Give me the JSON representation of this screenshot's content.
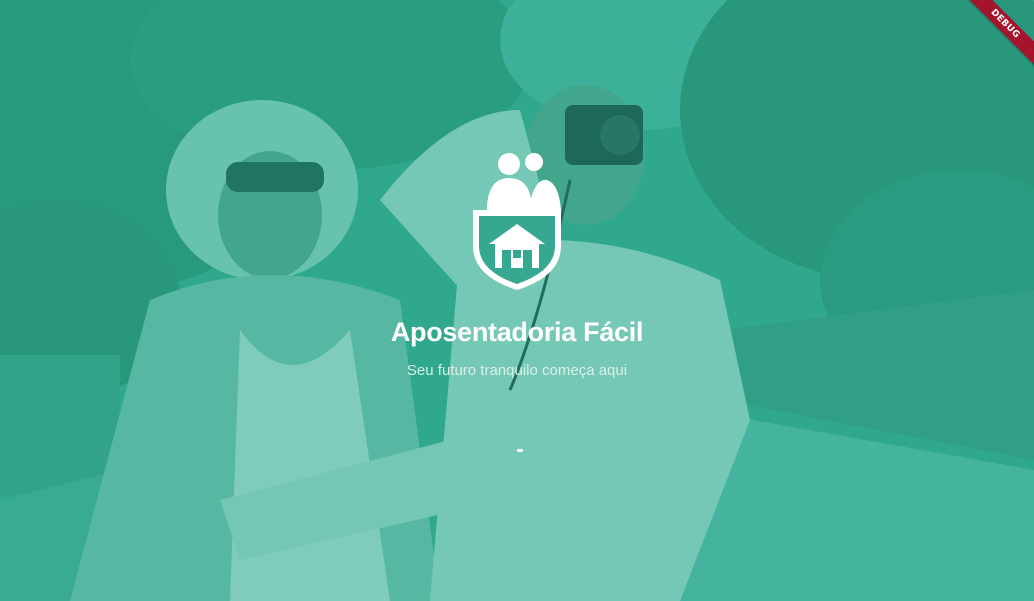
{
  "splash": {
    "title": "Aposentadoria Fácil",
    "subtitle": "Seu futuro tranquilo começa aqui"
  },
  "debug_banner": {
    "label": "DEBUG"
  },
  "icons": {
    "logo": "elderly-couple-house-shield-icon",
    "loader": "progress-indicator"
  },
  "colors": {
    "overlay": "#26a68c",
    "title": "#ffffff",
    "subtitle": "#d8efe9",
    "debug_ribbon": "#a5132c"
  }
}
